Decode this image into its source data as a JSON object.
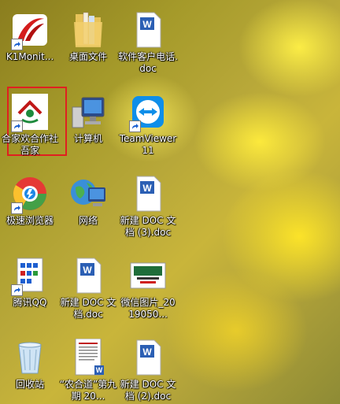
{
  "desktop": {
    "icons": [
      {
        "label": "K1Monit...",
        "type": "red-swoosh"
      },
      {
        "label": "桌面文件",
        "type": "folder"
      },
      {
        "label": "软件客户电话.doc",
        "type": "word-doc"
      },
      {
        "label": "合家欢合作社吾家",
        "type": "cooperative-logo"
      },
      {
        "label": "计算机",
        "type": "computer"
      },
      {
        "label": "TeamViewer 11",
        "type": "teamviewer"
      },
      {
        "label": "极速浏览器",
        "type": "browser"
      },
      {
        "label": "网络",
        "type": "network"
      },
      {
        "label": "新建 DOC 文档 (3).doc",
        "type": "word-doc"
      },
      {
        "label": "腾讯QQ",
        "type": "qq"
      },
      {
        "label": "新建 DOC 文档.doc",
        "type": "word-doc"
      },
      {
        "label": "微信图片_2019050...",
        "type": "image"
      },
      {
        "label": "回收站",
        "type": "recycle-bin"
      },
      {
        "label": "“农合道”第九期 20...",
        "type": "doc-preview"
      },
      {
        "label": "新建 DOC 文档 (2).doc",
        "type": "word-doc"
      }
    ],
    "colors": {
      "selection_border": "#e02020",
      "word_blue": "#2b5fb4",
      "teamviewer_blue": "#0e8ee9"
    }
  }
}
